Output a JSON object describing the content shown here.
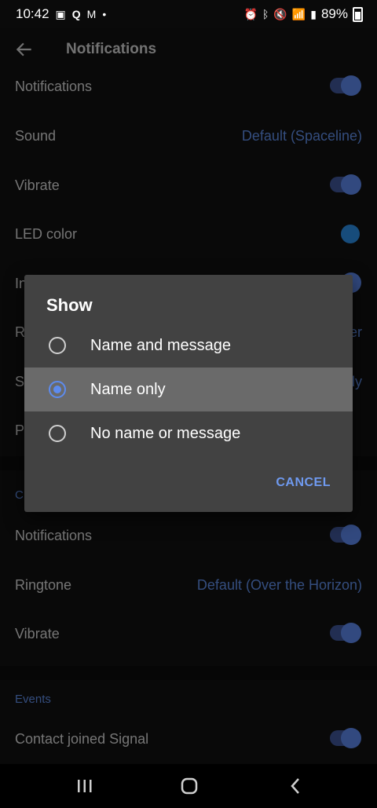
{
  "status_bar": {
    "time": "10:42",
    "battery": "89%",
    "icons_left": [
      "gallery-icon",
      "q-icon",
      "gmail-icon",
      "dot-icon"
    ],
    "icons_right": [
      "alarm-icon",
      "bluetooth-icon",
      "mute-icon",
      "wifi-icon",
      "volte-icon",
      "signal-icon",
      "battery-icon"
    ]
  },
  "app_bar": {
    "title": "Notifications"
  },
  "messages_section": {
    "rows": [
      {
        "label": "Notifications",
        "type": "toggle"
      },
      {
        "label": "Sound",
        "value": "Default (Spaceline)"
      },
      {
        "label": "Vibrate",
        "type": "toggle"
      },
      {
        "label": "LED color",
        "type": "color"
      },
      {
        "label": "In",
        "type": "toggle"
      },
      {
        "label": "R",
        "value": "er"
      },
      {
        "label": "S",
        "value": "ly"
      },
      {
        "label": "P"
      }
    ]
  },
  "calls_section": {
    "head": "C",
    "rows": [
      {
        "label": "Notifications",
        "type": "toggle"
      },
      {
        "label": "Ringtone",
        "value": "Default (Over the Horizon)"
      },
      {
        "label": "Vibrate",
        "type": "toggle"
      }
    ]
  },
  "events_section": {
    "head": "Events",
    "rows": [
      {
        "label": "Contact joined Signal",
        "type": "toggle"
      }
    ]
  },
  "dialog": {
    "title": "Show",
    "options": [
      {
        "label": "Name and message",
        "selected": false
      },
      {
        "label": "Name only",
        "selected": true
      },
      {
        "label": "No name or message",
        "selected": false
      }
    ],
    "cancel": "CANCEL"
  },
  "colors": {
    "accent": "#5d8bef",
    "led": "#2b8ae0",
    "dialog_bg": "#424242",
    "selected_row": "#6a6a6a"
  }
}
